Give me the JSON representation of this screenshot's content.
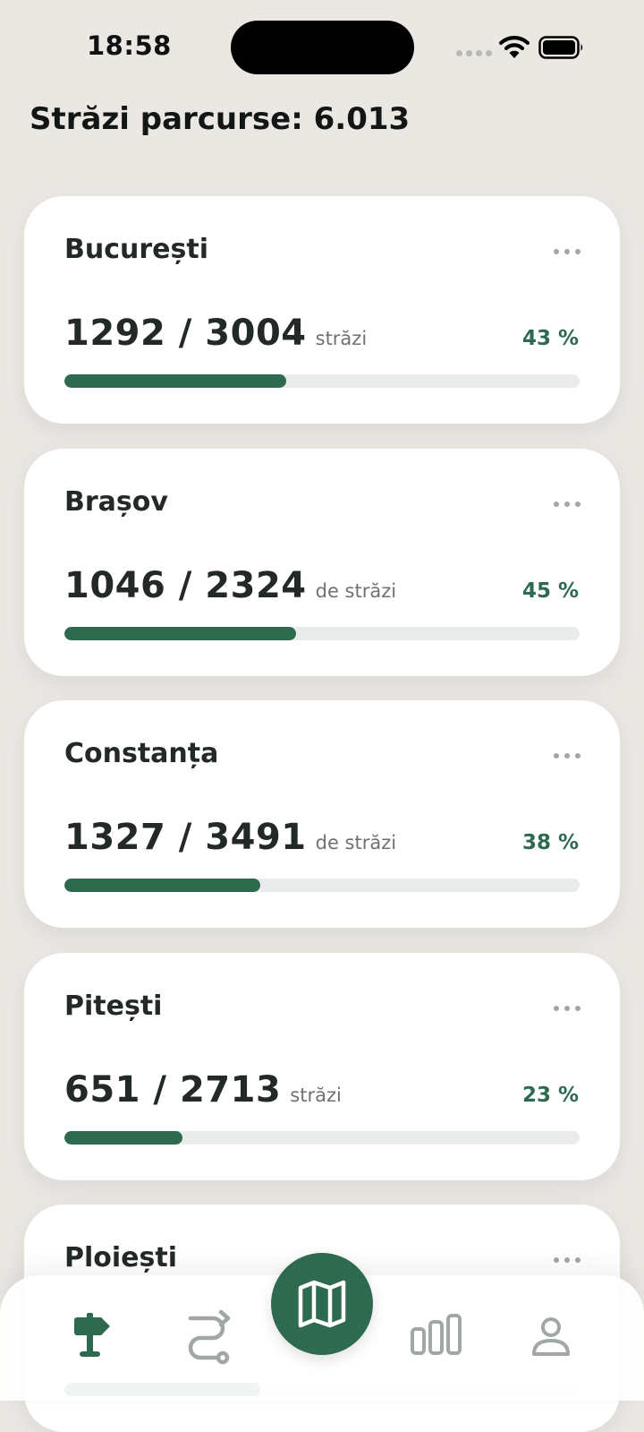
{
  "status_bar": {
    "time": "18:58"
  },
  "header": {
    "title": "Străzi parcurse: 6.013"
  },
  "cities": [
    {
      "name": "București",
      "done": "1292",
      "total": "3004",
      "unit": "străzi",
      "percent_label": "43 %",
      "progress": 0.43
    },
    {
      "name": "Brașov",
      "done": "1046",
      "total": "2324",
      "unit": "de străzi",
      "percent_label": "45 %",
      "progress": 0.45
    },
    {
      "name": "Constanța",
      "done": "1327",
      "total": "3491",
      "unit": "de străzi",
      "percent_label": "38 %",
      "progress": 0.38
    },
    {
      "name": "Pitești",
      "done": "651",
      "total": "2713",
      "unit": "străzi",
      "percent_label": "23 %",
      "progress": 0.23
    },
    {
      "name": "Ploiești",
      "done": "",
      "total": "",
      "unit": "",
      "percent_label": "",
      "progress": 0.38
    }
  ],
  "icons": {
    "menu": "more-horizontal-icon",
    "nav": [
      "signpost-icon",
      "route-icon",
      "map-icon",
      "bar-chart-icon",
      "profile-icon"
    ]
  },
  "colors": {
    "accent": "#2e6a50",
    "background": "#ebe8e4",
    "card": "#ffffff",
    "track": "#e9ecea"
  }
}
